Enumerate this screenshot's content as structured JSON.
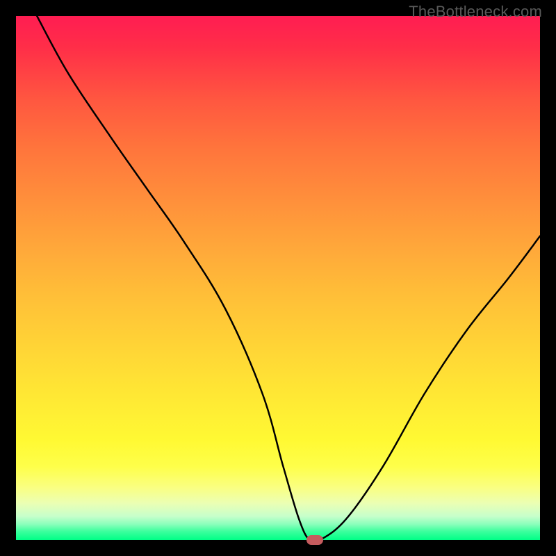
{
  "watermark": "TheBottleneck.com",
  "chart_data": {
    "type": "line",
    "title": "",
    "xlabel": "",
    "ylabel": "",
    "xlim": [
      0,
      100
    ],
    "ylim": [
      0,
      100
    ],
    "grid": false,
    "series": [
      {
        "name": "bottleneck-curve",
        "x": [
          4,
          10,
          18,
          25,
          32,
          40,
          47,
          51,
          54,
          56,
          58,
          63,
          70,
          78,
          86,
          94,
          100
        ],
        "values": [
          100,
          89,
          77,
          67,
          57,
          44,
          28,
          14,
          4,
          0,
          0,
          4,
          14,
          28,
          40,
          50,
          58
        ]
      }
    ],
    "marker": {
      "x": 57,
      "y": 0,
      "color": "#c55b5e"
    },
    "gradient_stops": [
      {
        "pos": 0,
        "color": "#ff1d52"
      },
      {
        "pos": 50,
        "color": "#ffbe38"
      },
      {
        "pos": 85,
        "color": "#feff4a"
      },
      {
        "pos": 100,
        "color": "#00ff87"
      }
    ]
  }
}
